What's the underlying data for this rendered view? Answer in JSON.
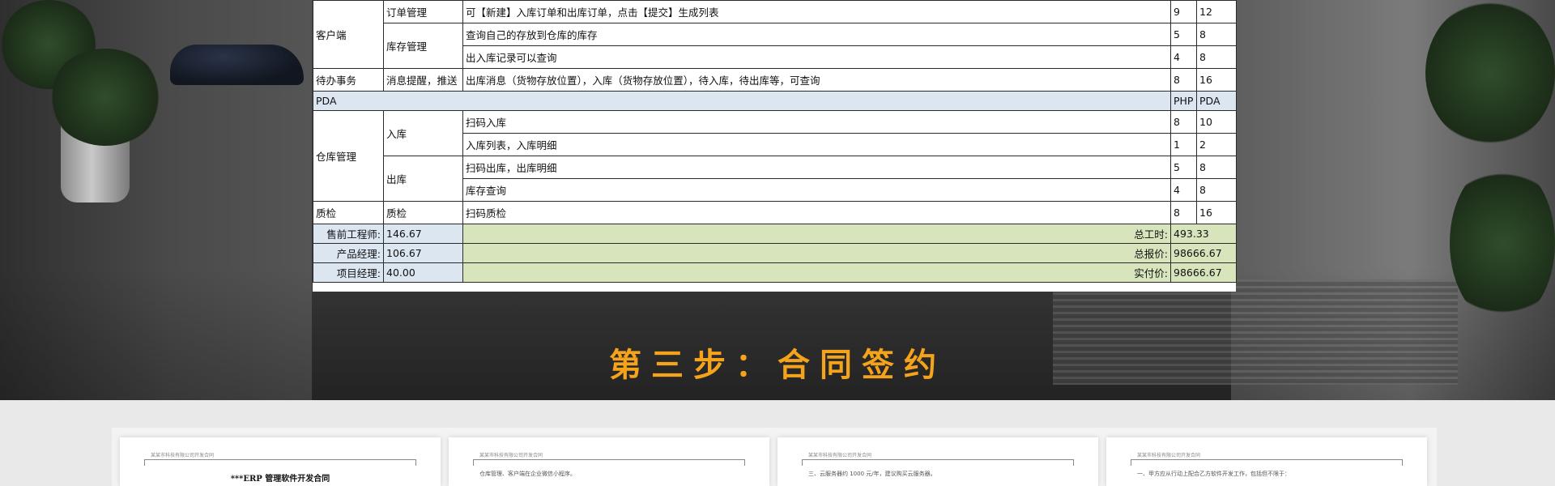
{
  "table": {
    "rows": [
      {
        "cat": "客户端",
        "sub": "订单管理",
        "desc": "可【新建】入库订单和出库订单，点击【提交】生成列表",
        "a": "9",
        "b": "12"
      },
      {
        "sub": "库存管理",
        "desc": "查询自己的存放到仓库的库存",
        "a": "5",
        "b": "8"
      },
      {
        "desc": "出入库记录可以查询",
        "a": "4",
        "b": "8"
      },
      {
        "cat": "待办事务",
        "sub": "消息提醒，推送",
        "desc": "出库消息（货物存放位置），入库（货物存放位置），待入库，待出库等，可查询",
        "a": "8",
        "b": "16"
      }
    ],
    "pda_row": {
      "label": "PDA",
      "a": "PHP",
      "b": "PDA"
    },
    "pda_rows": [
      {
        "cat": "仓库管理",
        "sub": "入库",
        "desc": "扫码入库",
        "a": "8",
        "b": "10"
      },
      {
        "desc": "入库列表，入库明细",
        "a": "1",
        "b": "2"
      },
      {
        "sub": "出库",
        "desc": "扫码出库，出库明细",
        "a": "5",
        "b": "8"
      },
      {
        "desc": "库存查询",
        "a": "4",
        "b": "8"
      },
      {
        "cat": "质检",
        "sub": "质检",
        "desc": "扫码质检",
        "a": "8",
        "b": "16"
      }
    ],
    "summary": [
      {
        "label": "售前工程师:",
        "value": "146.67",
        "right_label": "总工时:",
        "right_value": "493.33"
      },
      {
        "label": "产品经理:",
        "value": "106.67",
        "right_label": "总报价:",
        "right_value": "98666.67"
      },
      {
        "label": "项目经理:",
        "value": "40.00",
        "right_label": "实付价:",
        "right_value": "98666.67"
      }
    ]
  },
  "step_title": "第三步：合同签约",
  "docs": [
    {
      "header": "某某市科技有限公司开发合同",
      "title": "***ERP 管理软件开发合同",
      "line": ""
    },
    {
      "header": "某某市科技有限公司开发合同",
      "title": "",
      "line": "仓库管理、客户端在企业微信小程序。"
    },
    {
      "header": "某某市科技有限公司开发合同",
      "title": "",
      "line": "三、云服务器约 1000 元/年，建议购买云服务器。"
    },
    {
      "header": "某某市科技有限公司开发合同",
      "title": "",
      "line": "一、甲方应从行动上配合乙方软件开发工作，包括但不限于："
    }
  ]
}
